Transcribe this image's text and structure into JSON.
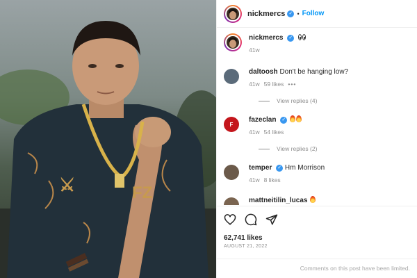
{
  "post": {
    "author": "nickmercs",
    "follow_label": "Follow",
    "caption_time": "41w",
    "likes": "62,741 likes",
    "date": "AUGUST 21, 2022",
    "comments_limited": "Comments on this post have been limited."
  },
  "comments": [
    {
      "user": "daltoosh",
      "text": "Don't be hanging low?",
      "time": "41w",
      "likes": "59 likes",
      "avatar_color": "#5b6b7a"
    },
    {
      "user": "fazeclan",
      "text": "",
      "time": "41w",
      "likes": "54 likes",
      "avatar_color": "#c4161c"
    },
    {
      "user": "temper",
      "text": "Hm Morrison",
      "time": "41w",
      "likes": "8 likes",
      "avatar_color": "#6b5a4a"
    },
    {
      "user": "mattneitilin_lucas",
      "text": "",
      "avatar_color": "#7a6450"
    }
  ],
  "replies": [
    {
      "label": "View replies (4)"
    },
    {
      "label": "View replies (2)"
    }
  ],
  "icons": {
    "like": "heart-icon",
    "comment": "comment-icon",
    "share": "paper-plane-icon",
    "verified": "verified-badge-icon",
    "more": "more-options-icon"
  },
  "colors": {
    "follow": "#0095f6",
    "verified": "#3897f0",
    "muted": "#8e8e8e"
  }
}
